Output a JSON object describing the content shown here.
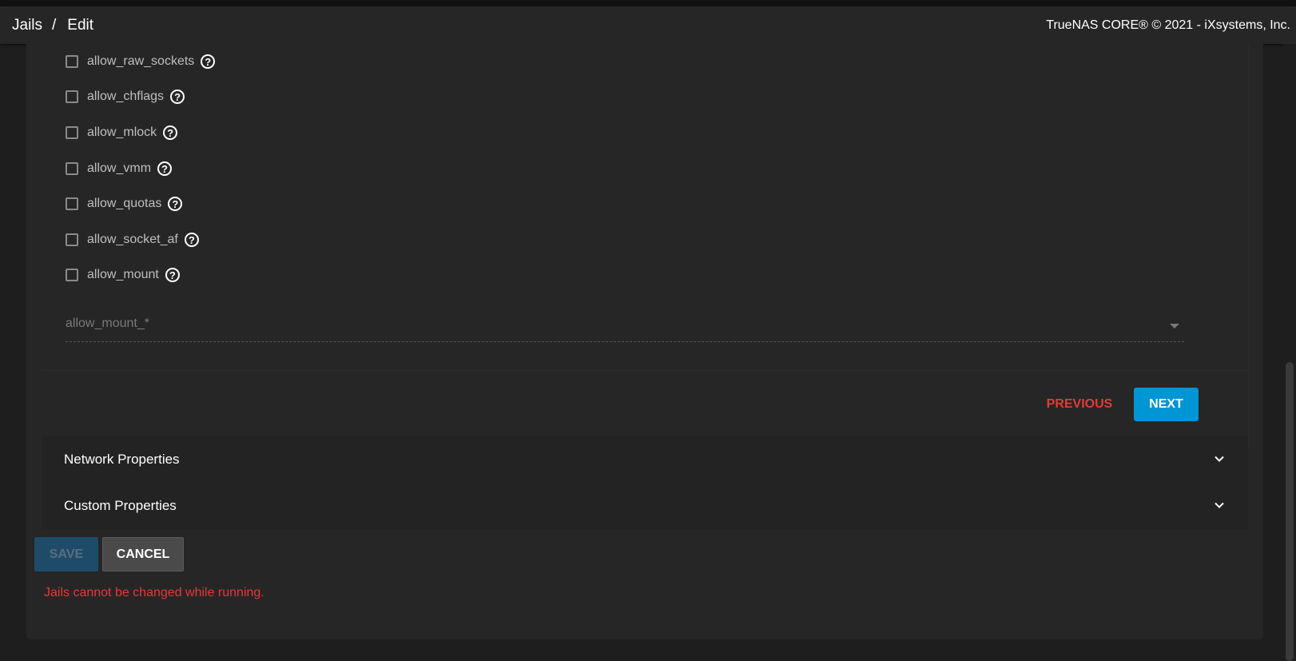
{
  "header": {
    "breadcrumb": [
      "Jails",
      "Edit"
    ],
    "separator": "/",
    "copyright": "TrueNAS CORE® © 2021 - iXsystems, Inc."
  },
  "checkboxes": [
    {
      "label": "allow_raw_sockets",
      "checked": false
    },
    {
      "label": "allow_chflags",
      "checked": false
    },
    {
      "label": "allow_mlock",
      "checked": false
    },
    {
      "label": "allow_vmm",
      "checked": false
    },
    {
      "label": "allow_quotas",
      "checked": false
    },
    {
      "label": "allow_socket_af",
      "checked": false
    },
    {
      "label": "allow_mount",
      "checked": false
    }
  ],
  "help_icon": "?",
  "select": {
    "placeholder": "allow_mount_*"
  },
  "stepper": {
    "previous_label": "PREVIOUS",
    "next_label": "NEXT"
  },
  "panels": [
    {
      "title": "Network Properties",
      "icon": "chevron-down-icon"
    },
    {
      "title": "Custom Properties",
      "icon": "chevron-down-icon"
    }
  ],
  "actions": {
    "save_label": "SAVE",
    "cancel_label": "CANCEL"
  },
  "error": "Jails cannot be changed while running.",
  "colors": {
    "accent": "#0095d5",
    "error": "#e53935",
    "background": "#1e1e1e",
    "card": "#262626"
  }
}
